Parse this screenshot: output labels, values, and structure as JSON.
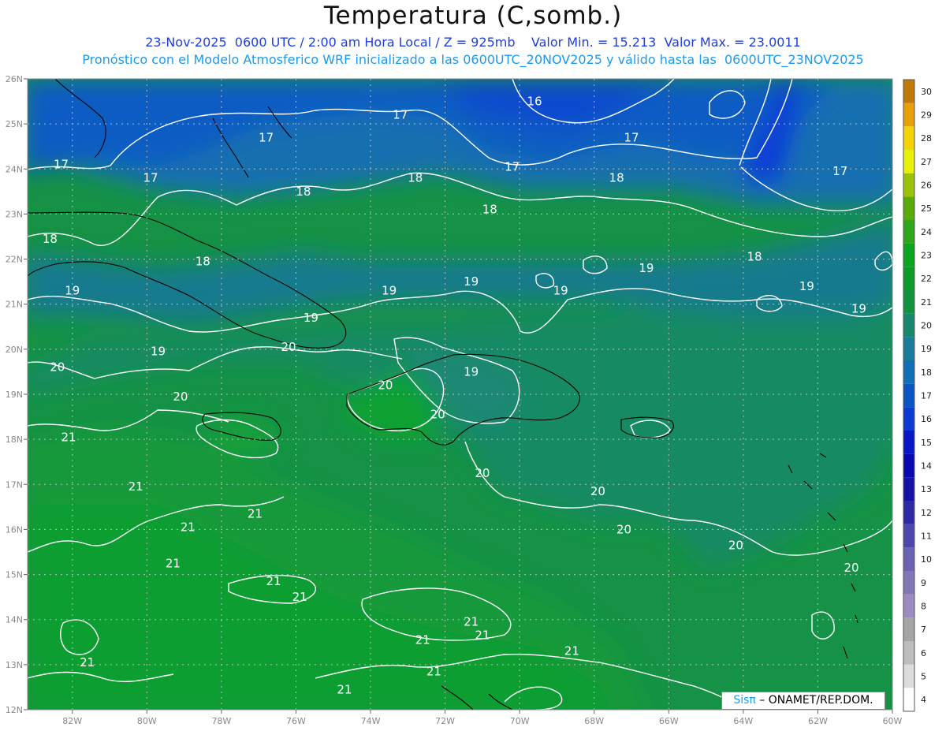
{
  "header": {
    "title": "Temperatura (C,somb.)",
    "line1": "23-Nov-2025  0600 UTC / 2:00 am Hora Local / Z = 925mb    Valor Min. = 15.213  Valor Max. = 23.0011",
    "line2": "Pronóstico con el Modelo Atmosferico WRF inicializado a las 0600UTC_20NOV2025 y válido hasta las  0600UTC_23NOV2025"
  },
  "credit": {
    "sis": "Sisπ",
    "rest": " – ONAMET/REP.DOM."
  },
  "chart_data": {
    "type": "heatmap",
    "title": "Temperatura (C,somb.)",
    "variable": "Temperature at 925mb (°C)",
    "value_min": 15.213,
    "value_max": 23.0011,
    "x_ticks": [
      "82W",
      "80W",
      "78W",
      "76W",
      "74W",
      "72W",
      "70W",
      "68W",
      "66W",
      "64W",
      "62W",
      "60W"
    ],
    "y_ticks": [
      "26N",
      "25N",
      "24N",
      "23N",
      "22N",
      "21N",
      "20N",
      "19N",
      "18N",
      "17N",
      "16N",
      "15N",
      "14N",
      "13N",
      "12N"
    ],
    "lon_range": [
      -83.2,
      -60
    ],
    "lat_range": [
      12,
      26
    ],
    "grid": true,
    "colorbar": {
      "placement": "right",
      "labels": [
        "4",
        "5",
        "6",
        "7",
        "8",
        "9",
        "10",
        "11",
        "12",
        "13",
        "14",
        "15",
        "16",
        "17",
        "18",
        "19",
        "20",
        "21",
        "22",
        "23",
        "24",
        "25",
        "26",
        "27",
        "28",
        "29",
        "30"
      ],
      "colors": [
        "#ffffff",
        "#dcdcdc",
        "#bdbdbd",
        "#a5a5a5",
        "#9a8cc0",
        "#8178b8",
        "#6b63b2",
        "#4d46ac",
        "#2e2aa6",
        "#1612a6",
        "#0a08b0",
        "#0818c8",
        "#0a3cd4",
        "#0b54c4",
        "#1070b6",
        "#1a7b9a",
        "#17876e",
        "#13913e",
        "#0e9c28",
        "#0aa51e",
        "#2ea81a",
        "#5aaa0a",
        "#9ac20a",
        "#e6f00a",
        "#f4d20a",
        "#e8a00a",
        "#c07a08"
      ]
    },
    "contours": {
      "levels": [
        16,
        17,
        18,
        19,
        20,
        21
      ],
      "labels": [
        {
          "v": "16",
          "lon": -69.6,
          "lat": 25.5
        },
        {
          "v": "17",
          "lon": -76.8,
          "lat": 24.7
        },
        {
          "v": "17",
          "lon": -73.2,
          "lat": 25.2
        },
        {
          "v": "17",
          "lon": -70.2,
          "lat": 24.05
        },
        {
          "v": "17",
          "lon": -67.0,
          "lat": 24.7
        },
        {
          "v": "17",
          "lon": -61.4,
          "lat": 23.95
        },
        {
          "v": "17",
          "lon": -82.3,
          "lat": 24.1
        },
        {
          "v": "17",
          "lon": -79.9,
          "lat": 23.8
        },
        {
          "v": "18",
          "lon": -72.8,
          "lat": 23.8
        },
        {
          "v": "18",
          "lon": -75.8,
          "lat": 23.5
        },
        {
          "v": "18",
          "lon": -67.4,
          "lat": 23.8
        },
        {
          "v": "18",
          "lon": -70.8,
          "lat": 23.1
        },
        {
          "v": "18",
          "lon": -82.6,
          "lat": 22.45
        },
        {
          "v": "18",
          "lon": -78.5,
          "lat": 21.95
        },
        {
          "v": "18",
          "lon": -63.7,
          "lat": 22.05
        },
        {
          "v": "19",
          "lon": -82.0,
          "lat": 21.3
        },
        {
          "v": "19",
          "lon": -73.5,
          "lat": 21.3
        },
        {
          "v": "19",
          "lon": -71.3,
          "lat": 21.5
        },
        {
          "v": "19",
          "lon": -68.9,
          "lat": 21.3
        },
        {
          "v": "19",
          "lon": -66.6,
          "lat": 21.8
        },
        {
          "v": "19",
          "lon": -62.3,
          "lat": 21.4
        },
        {
          "v": "19",
          "lon": -60.9,
          "lat": 20.9
        },
        {
          "v": "19",
          "lon": -75.6,
          "lat": 20.7
        },
        {
          "v": "19",
          "lon": -79.7,
          "lat": 19.95
        },
        {
          "v": "19",
          "lon": -71.3,
          "lat": 19.5
        },
        {
          "v": "20",
          "lon": -82.4,
          "lat": 19.6
        },
        {
          "v": "20",
          "lon": -76.2,
          "lat": 20.05
        },
        {
          "v": "20",
          "lon": -73.6,
          "lat": 19.2
        },
        {
          "v": "20",
          "lon": -79.1,
          "lat": 18.95
        },
        {
          "v": "20",
          "lon": -72.2,
          "lat": 18.55
        },
        {
          "v": "20",
          "lon": -71.0,
          "lat": 17.25
        },
        {
          "v": "20",
          "lon": -67.9,
          "lat": 16.85
        },
        {
          "v": "20",
          "lon": -67.2,
          "lat": 16.0
        },
        {
          "v": "20",
          "lon": -64.2,
          "lat": 15.65
        },
        {
          "v": "20",
          "lon": -61.1,
          "lat": 15.15
        },
        {
          "v": "21",
          "lon": -82.1,
          "lat": 18.05
        },
        {
          "v": "21",
          "lon": -80.3,
          "lat": 16.95
        },
        {
          "v": "21",
          "lon": -78.9,
          "lat": 16.05
        },
        {
          "v": "21",
          "lon": -77.1,
          "lat": 16.35
        },
        {
          "v": "21",
          "lon": -79.3,
          "lat": 15.25
        },
        {
          "v": "21",
          "lon": -76.6,
          "lat": 14.85
        },
        {
          "v": "21",
          "lon": -75.9,
          "lat": 14.5
        },
        {
          "v": "21",
          "lon": -71.3,
          "lat": 13.95
        },
        {
          "v": "21",
          "lon": -71.0,
          "lat": 13.65
        },
        {
          "v": "21",
          "lon": -72.6,
          "lat": 13.55
        },
        {
          "v": "21",
          "lon": -68.6,
          "lat": 13.3
        },
        {
          "v": "21",
          "lon": -81.6,
          "lat": 13.05
        },
        {
          "v": "21",
          "lon": -72.3,
          "lat": 12.85
        },
        {
          "v": "21",
          "lon": -74.7,
          "lat": 12.45
        }
      ]
    }
  }
}
